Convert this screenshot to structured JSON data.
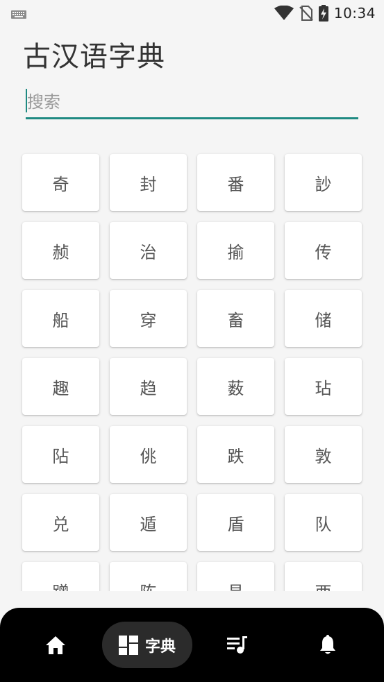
{
  "status_bar": {
    "time": "10:34",
    "icons": [
      "keyboard-icon",
      "wifi-icon",
      "no-sim-icon",
      "battery-charging-icon"
    ]
  },
  "header": {
    "title": "古汉语字典"
  },
  "search": {
    "placeholder": "搜索",
    "value": ""
  },
  "characters": [
    "奇",
    "封",
    "番",
    "訬",
    "赪",
    "治",
    "揄",
    "传",
    "船",
    "穿",
    "畜",
    "储",
    "趣",
    "趋",
    "薮",
    "玷",
    "阽",
    "佻",
    "跌",
    "敦",
    "兑",
    "遁",
    "盾",
    "队",
    "蹭",
    "陈",
    "昌",
    "酉"
  ],
  "bottom_nav": {
    "items": [
      {
        "icon": "home-icon",
        "label": ""
      },
      {
        "icon": "dictionary-icon",
        "label": "字典",
        "active": true
      },
      {
        "icon": "playlist-music-icon",
        "label": ""
      },
      {
        "icon": "bell-icon",
        "label": ""
      }
    ]
  },
  "colors": {
    "accent": "#1f8a82",
    "background": "#f5f5f5",
    "nav_background": "#000000",
    "nav_active_pill": "#2b2b2b"
  }
}
